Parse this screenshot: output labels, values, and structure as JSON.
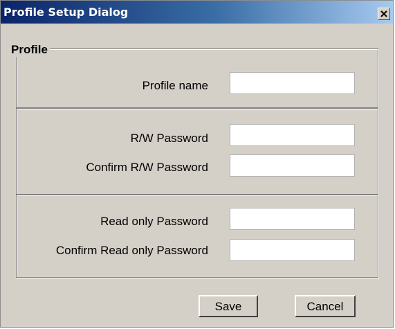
{
  "dialog": {
    "title": "Profile Setup Dialog",
    "close_icon": "close-icon"
  },
  "profile_group": {
    "legend": "Profile",
    "profile_name_label": "Profile name",
    "profile_name_value": ""
  },
  "rw_group": {
    "rw_password_label": "R/W Password",
    "confirm_rw_password_label": "Confirm  R/W Password",
    "rw_password_value": "",
    "confirm_rw_password_value": ""
  },
  "ro_group": {
    "ro_password_label": "Read only Password",
    "confirm_ro_password_label": "Confirm Read only Password",
    "ro_password_value": "",
    "confirm_ro_password_value": ""
  },
  "buttons": {
    "save_label": "Save",
    "cancel_label": "Cancel"
  }
}
